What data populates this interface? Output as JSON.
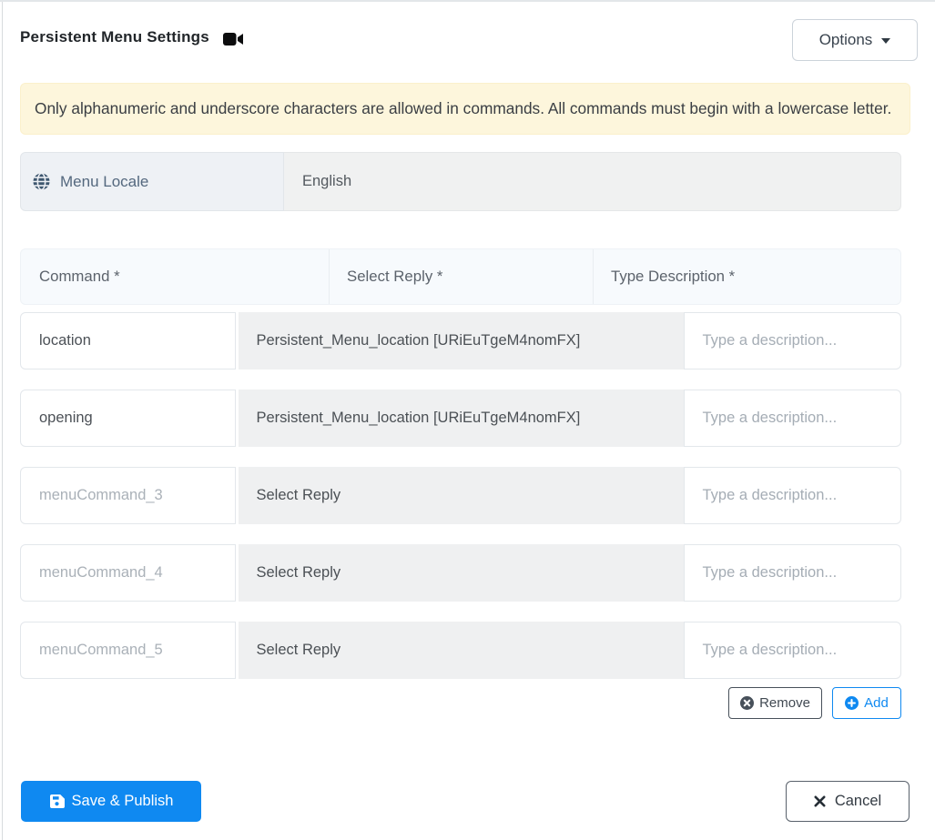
{
  "header": {
    "title": "Persistent Menu Settings",
    "title_icon": "video-camera-icon",
    "options_button": "Options"
  },
  "alert_message": "Only alphanumeric and underscore characters are allowed in commands. All commands must begin with a lowercase letter.",
  "locale": {
    "icon": "globe-icon",
    "label": "Menu Locale",
    "value": "English"
  },
  "command_table": {
    "column_headers": [
      "Command *",
      "Select Reply *",
      "Type Description *"
    ],
    "description_placeholder": "Type a description...",
    "rows": [
      {
        "command": "location",
        "command_is_placeholder": false,
        "reply": "Persistent_Menu_location [URiEuTgeM4nomFX]",
        "reply_is_selected": true,
        "description": "",
        "description_placeholder": "Type a description..."
      },
      {
        "command": "opening",
        "command_is_placeholder": false,
        "reply": "Persistent_Menu_location [URiEuTgeM4nomFX]",
        "reply_is_selected": true,
        "description": "",
        "description_placeholder": "Type a description..."
      },
      {
        "command": "menuCommand_3",
        "command_is_placeholder": true,
        "reply": "Select Reply",
        "reply_is_selected": false,
        "description": "",
        "description_placeholder": "Type a description..."
      },
      {
        "command": "menuCommand_4",
        "command_is_placeholder": true,
        "reply": "Select Reply",
        "reply_is_selected": false,
        "description": "",
        "description_placeholder": "Type a description..."
      },
      {
        "command": "menuCommand_5",
        "command_is_placeholder": true,
        "reply": "Select Reply",
        "reply_is_selected": false,
        "description": "",
        "description_placeholder": "Type a description..."
      }
    ]
  },
  "actions": {
    "remove": "Remove",
    "add": "Add",
    "save": "Save & Publish",
    "cancel": "Cancel"
  },
  "colors": {
    "primary_blue": "#0f89f1",
    "warning_bg": "#fdf6dc",
    "dark_slate": "#47505a"
  }
}
